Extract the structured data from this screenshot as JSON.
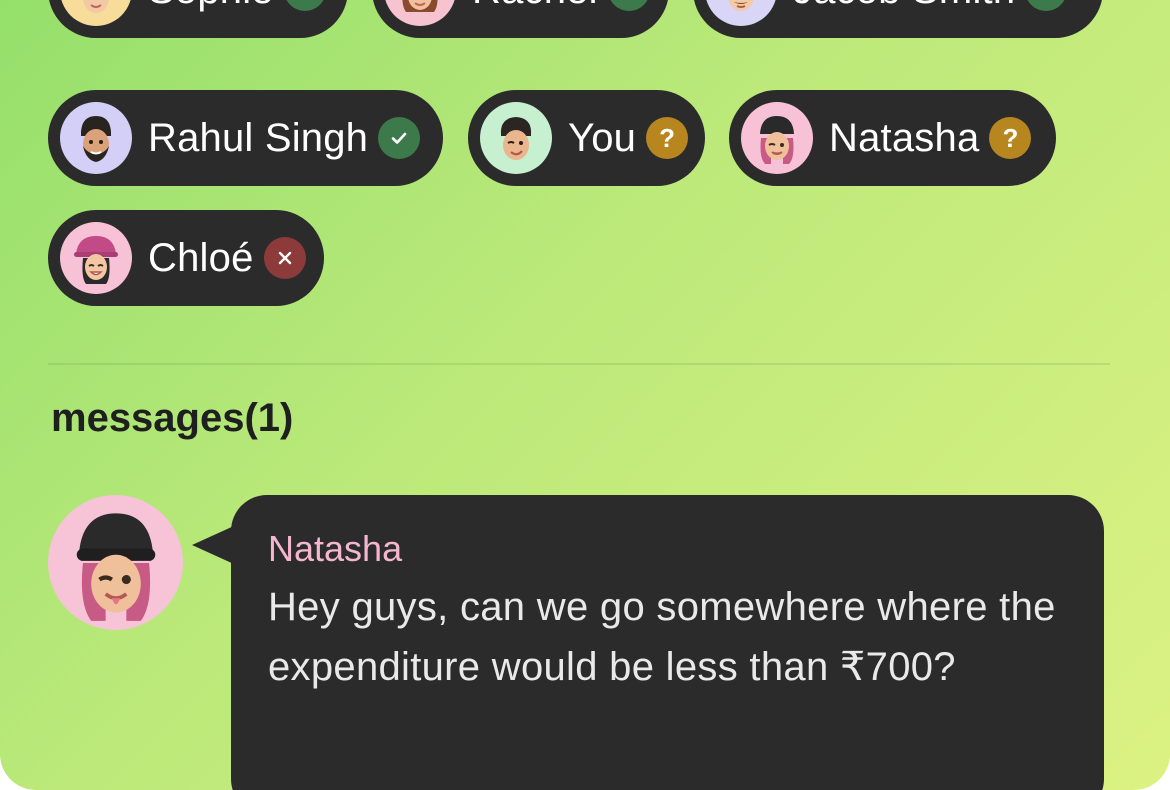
{
  "participants": [
    {
      "name": "Sophie",
      "status": "going",
      "status_icon": "check-icon",
      "avatar_bg": "#f8dc9a"
    },
    {
      "name": "Rachel",
      "status": "going",
      "status_icon": "check-icon",
      "avatar_bg": "#f6c4d0"
    },
    {
      "name": "Jacob Smith",
      "status": "going",
      "status_icon": "check-icon",
      "avatar_bg": "#d9d5f7"
    },
    {
      "name": "Rahul Singh",
      "status": "going",
      "status_icon": "check-icon",
      "avatar_bg": "#d3cff6"
    },
    {
      "name": "You",
      "status": "maybe",
      "status_icon": "question-icon",
      "status_glyph": "?",
      "avatar_bg": "#c6f0cf"
    },
    {
      "name": "Natasha",
      "status": "maybe",
      "status_icon": "question-icon",
      "status_glyph": "?",
      "avatar_bg": "#f8c2d6"
    },
    {
      "name": "Chloé",
      "status": "not-going",
      "status_icon": "x-icon",
      "avatar_bg": "#f8c2d6"
    }
  ],
  "messages": {
    "heading": "messages(1)",
    "items": [
      {
        "author": "Natasha",
        "text": "Hey guys, can we go somewhere where the expenditure would be less than ₹700?"
      }
    ]
  },
  "colors": {
    "going": "#3d7a4b",
    "maybe": "#b7861e",
    "not_going": "#8c3a3a",
    "chip_bg": "#2b2b2b",
    "author_name": "#f4b6cf"
  }
}
